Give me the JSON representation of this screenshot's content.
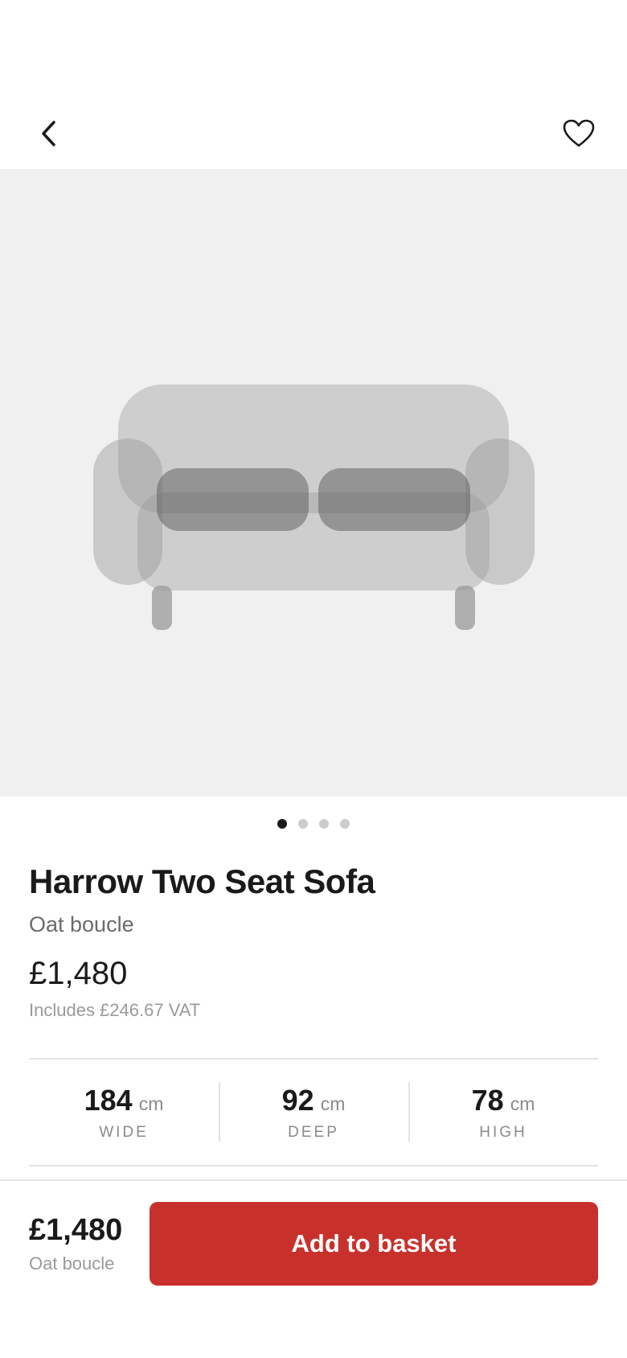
{
  "header": {
    "back_icon": "chevron-left-icon",
    "favorite_icon": "heart-outline-icon"
  },
  "gallery": {
    "image": "sofa-illustration",
    "total_images": 4,
    "active_index": 0
  },
  "product": {
    "name": "Harrow Two Seat Sofa",
    "variant": "Oat boucle",
    "price": "£1,480",
    "vat_note": "Includes £246.67 VAT"
  },
  "dimensions": [
    {
      "value": "184",
      "unit": "cm",
      "label": "WIDE"
    },
    {
      "value": "92",
      "unit": "cm",
      "label": "DEEP"
    },
    {
      "value": "78",
      "unit": "cm",
      "label": "HIGH"
    }
  ],
  "footer": {
    "price": "£1,480",
    "variant": "Oat boucle",
    "cta_label": "Add to basket"
  },
  "colors": {
    "accent": "#c8312b",
    "image_background": "#f0f0f0",
    "text_primary": "#1a1a1a",
    "text_secondary": "#6b6b6b",
    "text_muted": "#9a9a9a",
    "divider": "#e3e3e3"
  }
}
